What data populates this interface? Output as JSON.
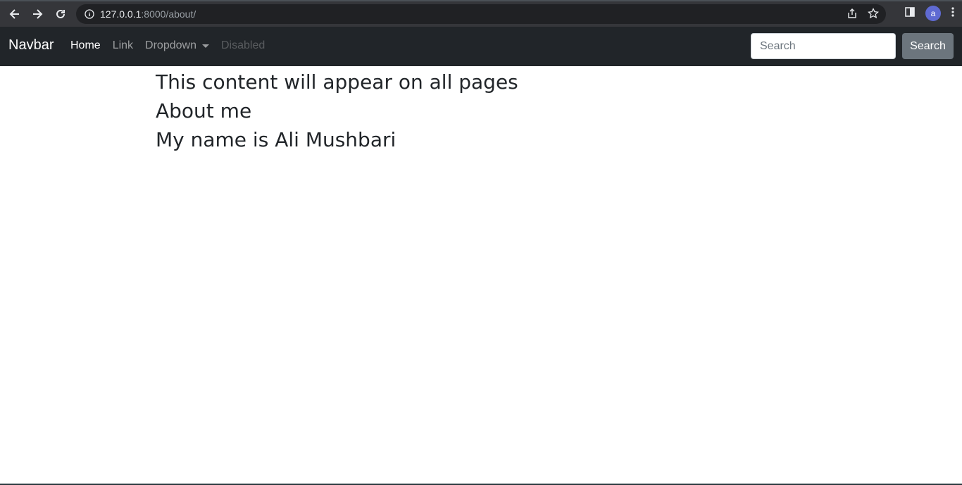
{
  "browser": {
    "url_host": "127.0.0.1",
    "url_path": ":8000/about/",
    "avatar_letter": "a"
  },
  "navbar": {
    "brand": "Navbar",
    "links": [
      {
        "label": "Home",
        "state": "active"
      },
      {
        "label": "Link",
        "state": "normal"
      },
      {
        "label": "Dropdown",
        "state": "normal"
      },
      {
        "label": "Disabled",
        "state": "disabled"
      }
    ],
    "search_placeholder": "Search",
    "search_button": "Search"
  },
  "content": {
    "line1": "This content will appear on all pages",
    "line2": "About me",
    "line3": "My name is Ali Mushbari"
  },
  "colors": {
    "navbar_bg": "#212529",
    "button_bg": "#6c757d",
    "text": "#212529"
  },
  "icons": [
    "back-arrow-icon",
    "forward-arrow-icon",
    "reload-icon",
    "info-icon",
    "share-icon",
    "star-icon",
    "side-panel-icon",
    "menu-dots-icon",
    "caret-down-icon"
  ]
}
